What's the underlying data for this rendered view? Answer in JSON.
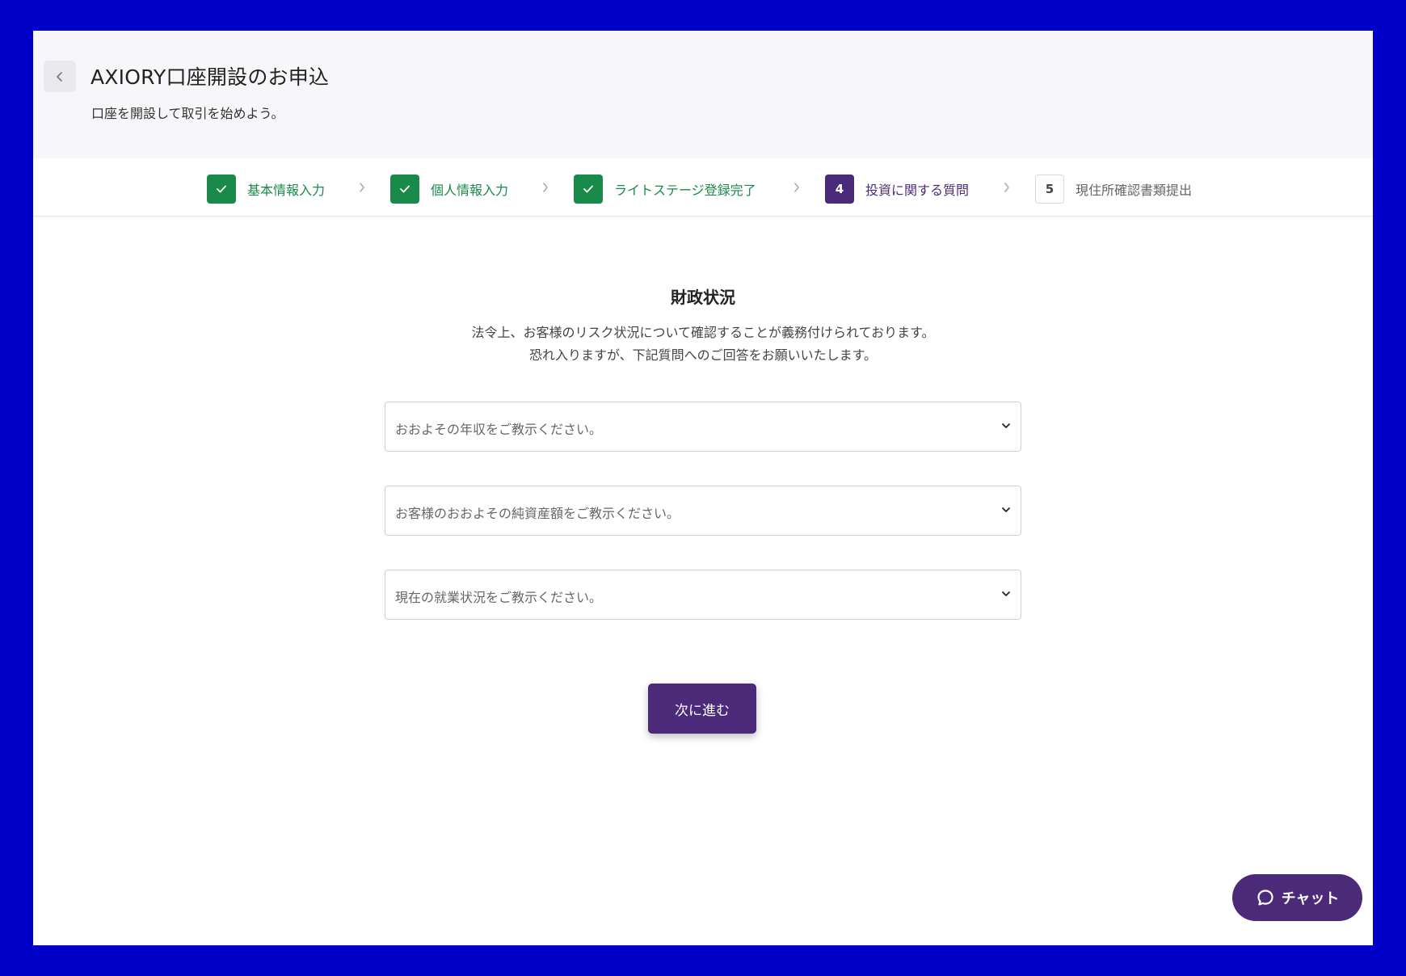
{
  "header": {
    "title": "AXIORY口座開設のお申込",
    "subtitle": "口座を開設して取引を始めよう。"
  },
  "steps": [
    {
      "label": "基本情報入力",
      "status": "done"
    },
    {
      "label": "個人情報入力",
      "status": "done"
    },
    {
      "label": "ライトステージ登録完了",
      "status": "done"
    },
    {
      "number": "4",
      "label": "投資に関する質問",
      "status": "current"
    },
    {
      "number": "5",
      "label": "現住所確認書類提出",
      "status": "todo"
    }
  ],
  "content": {
    "title": "財政状況",
    "description_line1": "法令上、お客様のリスク状況について確認することが義務付けられております。",
    "description_line2": "恐れ入りますが、下記質問へのご回答をお願いいたします。"
  },
  "form": {
    "income_placeholder": "おおよその年収をご教示ください。",
    "assets_placeholder": "お客様のおおよその純資産額をご教示ください。",
    "employment_placeholder": "現在の就業状況をご教示ください。"
  },
  "actions": {
    "next_label": "次に進む",
    "chat_label": "チャット"
  },
  "colors": {
    "background_frame": "#0000c8",
    "done_green": "#1a8a4a",
    "accent_purple": "#4b2a7a"
  },
  "icons": {
    "back": "chevron-left-icon",
    "step_done": "check-icon",
    "step_separator": "chevron-right-icon",
    "select": "chevron-down-icon",
    "chat": "chat-bubble-icon"
  }
}
